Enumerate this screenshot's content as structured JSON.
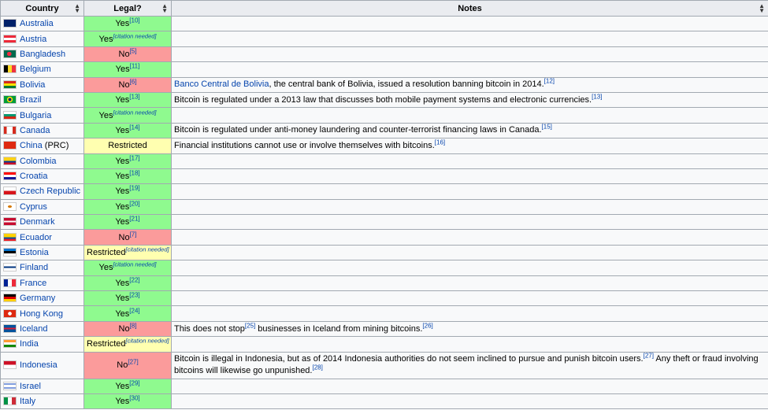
{
  "headers": {
    "country": "Country",
    "legal": "Legal?",
    "notes": "Notes"
  },
  "rows": [
    {
      "country": "Australia",
      "flag": "australia-flag-icon",
      "status": "yes",
      "legal": "Yes",
      "legal_ref": "[10]",
      "notes": ""
    },
    {
      "country": "Austria",
      "flag": "austria-flag-icon",
      "status": "yes",
      "legal": "Yes",
      "legal_ref": "[citation needed]",
      "notes": ""
    },
    {
      "country": "Bangladesh",
      "flag": "bangladesh-flag-icon",
      "status": "no",
      "legal": "No",
      "legal_ref": "[5]",
      "notes": ""
    },
    {
      "country": "Belgium",
      "flag": "belgium-flag-icon",
      "status": "yes",
      "legal": "Yes",
      "legal_ref": "[11]",
      "notes": ""
    },
    {
      "country": "Bolivia",
      "flag": "bolivia-flag-icon",
      "status": "no",
      "legal": "No",
      "legal_ref": "[6]",
      "notes_link": "Banco Central de Bolivia",
      "notes": ", the central bank of Bolivia, issued a resolution banning bitcoin in 2014.",
      "notes_ref": "[12]"
    },
    {
      "country": "Brazil",
      "flag": "brazil-flag-icon",
      "status": "yes",
      "legal": "Yes",
      "legal_ref": "[13]",
      "notes": "Bitcoin is regulated under a 2013 law that discusses both mobile payment systems and electronic currencies.",
      "notes_ref": "[13]"
    },
    {
      "country": "Bulgaria",
      "flag": "bulgaria-flag-icon",
      "status": "yes",
      "legal": "Yes",
      "legal_ref": "[citation needed]",
      "notes": ""
    },
    {
      "country": "Canada",
      "flag": "canada-flag-icon",
      "status": "yes",
      "legal": "Yes",
      "legal_ref": "[14]",
      "notes": "Bitcoin is regulated under anti-money laundering and counter-terrorist financing laws in Canada.",
      "notes_ref": "[15]"
    },
    {
      "country": "China",
      "country_suffix": " (PRC)",
      "flag": "china-flag-icon",
      "status": "restricted",
      "legal": "Restricted",
      "legal_ref": "",
      "notes": "Financial institutions cannot use or involve themselves with bitcoins.",
      "notes_ref": "[16]"
    },
    {
      "country": "Colombia",
      "flag": "colombia-flag-icon",
      "status": "yes",
      "legal": "Yes",
      "legal_ref": "[17]",
      "notes": ""
    },
    {
      "country": "Croatia",
      "flag": "croatia-flag-icon",
      "status": "yes",
      "legal": "Yes",
      "legal_ref": "[18]",
      "notes": ""
    },
    {
      "country": "Czech Republic",
      "flag": "czech-republic-flag-icon",
      "status": "yes",
      "legal": "Yes",
      "legal_ref": "[19]",
      "notes": ""
    },
    {
      "country": "Cyprus",
      "flag": "cyprus-flag-icon",
      "status": "yes",
      "legal": "Yes",
      "legal_ref": "[20]",
      "notes": ""
    },
    {
      "country": "Denmark",
      "flag": "denmark-flag-icon",
      "status": "yes",
      "legal": "Yes",
      "legal_ref": "[21]",
      "notes": ""
    },
    {
      "country": "Ecuador",
      "flag": "ecuador-flag-icon",
      "status": "no",
      "legal": "No",
      "legal_ref": "[7]",
      "notes": ""
    },
    {
      "country": "Estonia",
      "flag": "estonia-flag-icon",
      "status": "restricted",
      "legal": "Restricted",
      "legal_ref": "[citation needed]",
      "notes": ""
    },
    {
      "country": "Finland",
      "flag": "finland-flag-icon",
      "status": "yes",
      "legal": "Yes",
      "legal_ref": "[citation needed]",
      "notes": ""
    },
    {
      "country": "France",
      "flag": "france-flag-icon",
      "status": "yes",
      "legal": "Yes",
      "legal_ref": "[22]",
      "notes": ""
    },
    {
      "country": "Germany",
      "flag": "germany-flag-icon",
      "status": "yes",
      "legal": "Yes",
      "legal_ref": "[23]",
      "notes": ""
    },
    {
      "country": "Hong Kong",
      "flag": "hong-kong-flag-icon",
      "status": "yes",
      "legal": "Yes",
      "legal_ref": "[24]",
      "notes": ""
    },
    {
      "country": "Iceland",
      "flag": "iceland-flag-icon",
      "status": "no",
      "legal": "No",
      "legal_ref": "[8]",
      "notes": "This does not stop",
      "notes_ref_mid": "[25]",
      "notes_after": " businesses in Iceland from mining bitcoins.",
      "notes_ref": "[26]"
    },
    {
      "country": "India",
      "flag": "india-flag-icon",
      "status": "restricted",
      "legal": "Restricted",
      "legal_ref": "[citation needed]",
      "notes": ""
    },
    {
      "country": "Indonesia",
      "flag": "indonesia-flag-icon",
      "status": "no",
      "legal": "No",
      "legal_ref": "[27]",
      "notes": "Bitcoin is illegal in Indonesia, but as of 2014 Indonesia authorities do not seem inclined to pursue and punish bitcoin users.",
      "notes_ref_mid": "[27]",
      "notes_after": " Any theft or fraud involving bitcoins will likewise go unpunished.",
      "notes_ref": "[28]"
    },
    {
      "country": "Israel",
      "flag": "israel-flag-icon",
      "status": "yes",
      "legal": "Yes",
      "legal_ref": "[29]",
      "notes": ""
    },
    {
      "country": "Italy",
      "flag": "italy-flag-icon",
      "status": "yes",
      "legal": "Yes",
      "legal_ref": "[30]",
      "notes": ""
    }
  ],
  "flags": {
    "australia-flag-icon": "linear-gradient(#012169,#012169)",
    "austria-flag-icon": "linear-gradient(#ed2939 33%,#ffffff 33%,#ffffff 66%,#ed2939 66%)",
    "bangladesh-flag-icon": "radial-gradient(circle at 45% 50%,#f42a41 28%,#006a4e 30%)",
    "belgium-flag-icon": "linear-gradient(90deg,#000000 33%,#fdda24 33%,#fdda24 66%,#ef3340 66%)",
    "bolivia-flag-icon": "linear-gradient(#d52b1e 33%,#f9e300 33%,#f9e300 66%,#007934 66%)",
    "brazil-flag-icon": "radial-gradient(circle,#002776 22%,#ffdf00 24%,#ffdf00 40%,#009c3b 42%)",
    "bulgaria-flag-icon": "linear-gradient(#ffffff 33%,#00966e 33%,#00966e 66%,#d62612 66%)",
    "canada-flag-icon": "linear-gradient(90deg,#d52b1e 25%,#ffffff 25%,#ffffff 75%,#d52b1e 75%)",
    "china-flag-icon": "linear-gradient(#de2910,#de2910)",
    "colombia-flag-icon": "linear-gradient(#fcd116 50%,#003893 50%,#003893 75%,#ce1126 75%)",
    "croatia-flag-icon": "linear-gradient(#ff0000 33%,#ffffff 33%,#ffffff 66%,#171796 66%)",
    "czech-republic-flag-icon": "linear-gradient(#ffffff 50%,#d7141a 50%)",
    "cyprus-flag-icon": "radial-gradient(ellipse at 50% 50%,#d57800 22%,#ffffff 26%)",
    "denmark-flag-icon": "linear-gradient(#c60c30 40%,#ffffff 40%,#ffffff 60%,#c60c30 60%)",
    "ecuador-flag-icon": "linear-gradient(#ffd100 50%,#034ea2 50%,#034ea2 75%,#ed1c24 75%)",
    "estonia-flag-icon": "linear-gradient(#0072ce 33%,#000000 33%,#000000 66%,#ffffff 66%)",
    "finland-flag-icon": "linear-gradient(#ffffff 38%,#003580 38%,#003580 62%,#ffffff 62%)",
    "france-flag-icon": "linear-gradient(90deg,#002395 33%,#ffffff 33%,#ffffff 66%,#ed2939 66%)",
    "germany-flag-icon": "linear-gradient(#000000 33%,#dd0000 33%,#dd0000 66%,#ffce00 66%)",
    "hong-kong-flag-icon": "radial-gradient(circle,#ffffff 25%,#de2910 28%)",
    "iceland-flag-icon": "linear-gradient(#02529c 38%,#dc1e35 38%,#dc1e35 62%,#02529c 62%)",
    "india-flag-icon": "linear-gradient(#ff9933 33%,#ffffff 33%,#ffffff 66%,#138808 66%)",
    "indonesia-flag-icon": "linear-gradient(#ce1126 50%,#ffffff 50%)",
    "israel-flag-icon": "linear-gradient(#ffffff 15%,#0038b8 15%,#0038b8 28%,#ffffff 28%,#ffffff 72%,#0038b8 72%,#0038b8 85%,#ffffff 85%)",
    "italy-flag-icon": "linear-gradient(90deg,#009246 33%,#ffffff 33%,#ffffff 66%,#ce2b37 66%)"
  },
  "colors": {
    "yes": "#8ffa8f",
    "no": "#fb9b9b",
    "restricted": "#ffffb0",
    "link": "#0645ad"
  },
  "sort_icon": "sort-arrows-icon"
}
